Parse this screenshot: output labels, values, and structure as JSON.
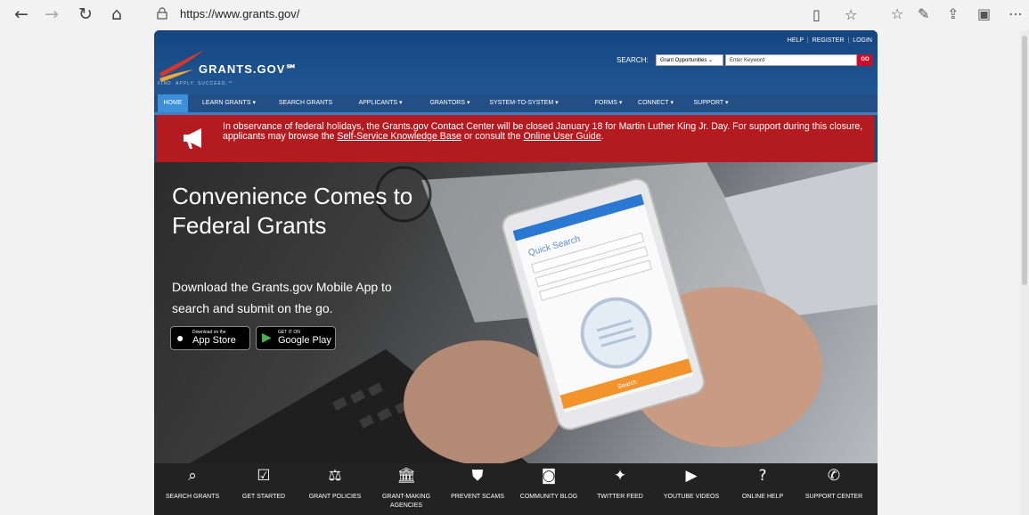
{
  "browser": {
    "url": "https://www.grants.gov/",
    "icons": [
      "back-icon",
      "forward-icon",
      "refresh-icon",
      "home-icon",
      "lock-icon",
      "reading-view-icon",
      "favorite-star-icon",
      "favorites-hub-icon",
      "pen-icon",
      "share-icon",
      "collections-icon",
      "more-icon"
    ]
  },
  "header": {
    "logo_text": "GRANTS.GOV℠",
    "tagline": "FIND. APPLY. SUCCEED.℠",
    "util_links": [
      "HELP",
      "REGISTER",
      "LOGIN"
    ],
    "search_label": "SEARCH:",
    "search_select": "Grant Opportunities",
    "search_placeholder": "Enter Keyword",
    "go_label": "GO"
  },
  "menu": {
    "items": [
      "HOME",
      "LEARN GRANTS",
      "SEARCH GRANTS",
      "APPLICANTS",
      "GRANTORS",
      "SYSTEM-TO-SYSTEM",
      "FORMS",
      "CONNECT",
      "SUPPORT"
    ],
    "active": "HOME"
  },
  "alert": {
    "text_before": "In observance of federal holidays, the Grants.gov Contact Center will be closed January 18 for Martin Luther King Jr. Day. For support during this closure, applicants may browse the ",
    "link1": "Self-Service Knowledge Base",
    "text_middle": " or consult the ",
    "link2": "Online User Guide",
    "text_after": "."
  },
  "hero": {
    "title": "Convenience Comes to Federal Grants",
    "subtitle": "Download the Grants.gov Mobile App to search and submit on the go.",
    "app_store_small": "Download on the",
    "app_store": "App Store",
    "google_small": "GET IT ON",
    "google": "Google Play",
    "phone_heading": "Quick Search",
    "phone_button": "Search"
  },
  "tiles": [
    {
      "icon": "binoculars-icon",
      "glyph": "⌕",
      "label": "SEARCH GRANTS"
    },
    {
      "icon": "checkbox-icon",
      "glyph": "☑",
      "label": "GET STARTED"
    },
    {
      "icon": "scales-icon",
      "glyph": "⚖",
      "label": "GRANT POLICIES"
    },
    {
      "icon": "building-icon",
      "glyph": "🏛",
      "label": "GRANT-MAKING AGENCIES"
    },
    {
      "icon": "shield-icon",
      "glyph": "⛊",
      "label": "PREVENT SCAMS"
    },
    {
      "icon": "rss-icon",
      "glyph": "◙",
      "label": "COMMUNITY BLOG"
    },
    {
      "icon": "twitter-icon",
      "glyph": "✦",
      "label": "TWITTER FEED"
    },
    {
      "icon": "youtube-icon",
      "glyph": "▶",
      "label": "YOUTUBE VIDEOS"
    },
    {
      "icon": "help-icon",
      "glyph": "?",
      "label": "ONLINE HELP"
    },
    {
      "icon": "phone-icon",
      "glyph": "✆",
      "label": "SUPPORT CENTER"
    }
  ],
  "colors": {
    "brand_blue": "#1a4a86",
    "alert_red": "#b41b20",
    "go_red": "#c8102e",
    "menu_active": "#3b90d9"
  }
}
